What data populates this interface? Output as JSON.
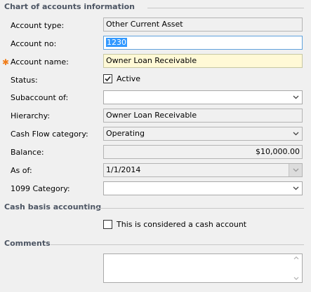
{
  "sections": {
    "chart_info": "Chart of accounts information",
    "cash_basis": "Cash basis accounting",
    "comments": "Comments"
  },
  "labels": {
    "account_type": "Account type:",
    "account_no": "Account no:",
    "account_name": "Account name:",
    "status": "Status:",
    "subaccount_of": "Subaccount of:",
    "hierarchy": "Hierarchy:",
    "cash_flow_category": "Cash Flow category:",
    "balance": "Balance:",
    "as_of": "As of:",
    "category_1099": "1099 Category:"
  },
  "values": {
    "account_type": "Other Current Asset",
    "account_no": "1230",
    "account_name": "Owner Loan Receivable",
    "status_active_label": "Active",
    "status_active_checked": true,
    "subaccount_of": "",
    "hierarchy": "Owner Loan Receivable",
    "cash_flow_category": "Operating",
    "balance": "$10,000.00",
    "as_of": "1/1/2014",
    "category_1099": "",
    "cash_account_label": "This is considered a cash account",
    "cash_account_checked": false,
    "comments": ""
  },
  "icons": {
    "dropdown": "chevron-down-icon",
    "check": "checkmark-icon",
    "scroll_up": "scroll-up-arrow-icon",
    "scroll_down": "scroll-down-arrow-icon"
  },
  "colors": {
    "section_title": "#4c5563",
    "required_star": "#f07d1a",
    "focus_border": "#5fa2dd",
    "highlight_bg": "#fff9d6",
    "selection_bg": "#3399ff"
  }
}
